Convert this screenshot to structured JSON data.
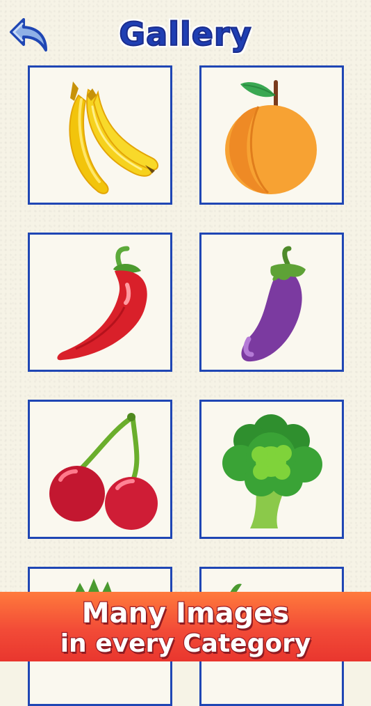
{
  "header": {
    "title": "Gallery",
    "back_icon": "back-arrow-icon"
  },
  "gallery": {
    "items": [
      {
        "name": "banana",
        "icon": "banana-icon"
      },
      {
        "name": "peach",
        "icon": "peach-icon"
      },
      {
        "name": "chili pepper",
        "icon": "chili-pepper-icon"
      },
      {
        "name": "eggplant",
        "icon": "eggplant-icon"
      },
      {
        "name": "cherries",
        "icon": "cherries-icon"
      },
      {
        "name": "broccoli",
        "icon": "broccoli-icon"
      },
      {
        "name": "pineapple",
        "icon": "pineapple-icon"
      },
      {
        "name": "carrot",
        "icon": "carrot-icon"
      }
    ]
  },
  "banner": {
    "line1": "Many Images",
    "line2": "in every Category"
  },
  "colors": {
    "frame": "#1f46b4",
    "title": "#1f3fb3",
    "banner": "#f24b37",
    "background": "#f6f3e6"
  }
}
